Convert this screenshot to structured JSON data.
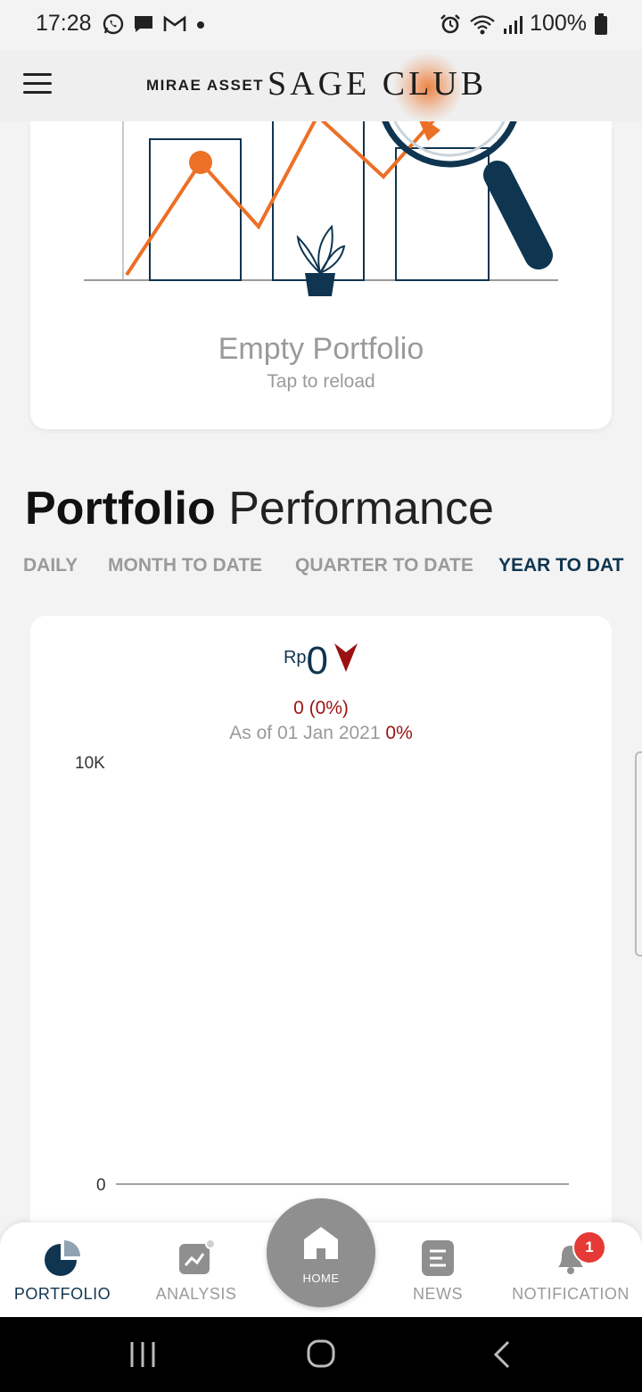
{
  "status_bar": {
    "time": "17:28",
    "battery": "100%",
    "icons": [
      "whatsapp-icon",
      "message-icon",
      "gmail-icon",
      "dot-icon",
      "alarm-icon",
      "wifi-icon",
      "signal-icon",
      "battery-icon"
    ]
  },
  "header": {
    "brand_small": "MIRAE ASSET",
    "brand_large": "SAGE CLUB",
    "accent_color": "#ec7026"
  },
  "empty_portfolio": {
    "title": "Empty Portfolio",
    "subtitle": "Tap to reload"
  },
  "performance": {
    "title_bold": "Portfolio",
    "title_light": "Performance",
    "tabs": [
      {
        "label": "DAILY"
      },
      {
        "label": "MONTH TO DATE"
      },
      {
        "label": "QUARTER TO DATE"
      },
      {
        "label": "YEAR TO DAT"
      }
    ],
    "active_tab": "YEAR TO DAT",
    "currency": "Rp",
    "value": "0",
    "change": "0 (0%)",
    "as_of": "As of 01 Jan 2021",
    "as_of_pct": "0%",
    "down_color": "#9b1111",
    "chart_data": {
      "type": "line",
      "y_ticks": [
        "10K",
        "0"
      ],
      "ylim": [
        0,
        10000
      ],
      "series": []
    }
  },
  "bottom_nav": {
    "items": [
      {
        "label": "PORTFOLIO",
        "icon": "pie-chart-icon"
      },
      {
        "label": "ANALYSIS",
        "icon": "analysis-chart-icon"
      },
      {
        "label": "HOME",
        "icon": "home-icon"
      },
      {
        "label": "NEWS",
        "icon": "news-icon"
      },
      {
        "label": "NOTIFICATION",
        "icon": "bell-icon"
      }
    ],
    "active": "PORTFOLIO",
    "notification_count": "1"
  },
  "system_nav": {
    "icons": [
      "recent-apps-icon",
      "home-circle-icon",
      "back-icon"
    ]
  }
}
